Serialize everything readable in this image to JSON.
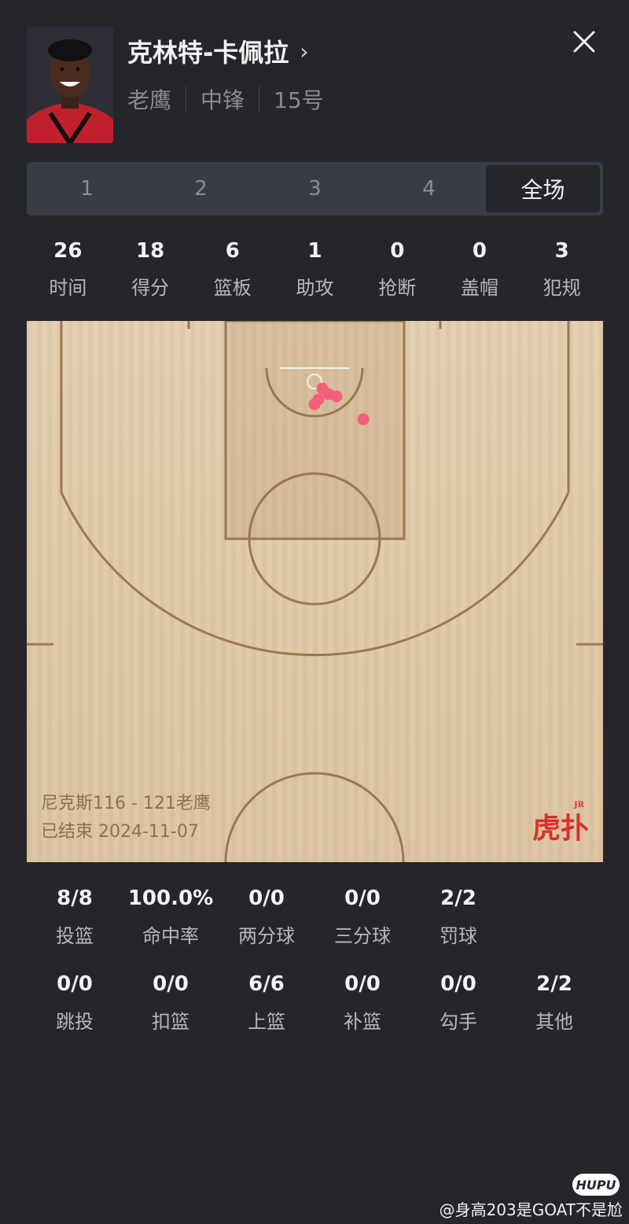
{
  "player": {
    "name": "克林特-卡佩拉",
    "team": "老鹰",
    "position": "中锋",
    "number": "15号"
  },
  "tabs": [
    {
      "label": "1",
      "active": false
    },
    {
      "label": "2",
      "active": false
    },
    {
      "label": "3",
      "active": false
    },
    {
      "label": "4",
      "active": false
    },
    {
      "label": "全场",
      "active": true
    }
  ],
  "stats": [
    {
      "label": "时间",
      "value": "26"
    },
    {
      "label": "得分",
      "value": "18"
    },
    {
      "label": "篮板",
      "value": "6"
    },
    {
      "label": "助攻",
      "value": "1"
    },
    {
      "label": "抢断",
      "value": "0"
    },
    {
      "label": "盖帽",
      "value": "0"
    },
    {
      "label": "犯规",
      "value": "3"
    }
  ],
  "game": {
    "score_line": "尼克斯116 - 121老鹰",
    "status_line": "已结束 2024-11-07"
  },
  "logo": {
    "text": "虎扑",
    "badge": "JR"
  },
  "shot_stats_row1": [
    {
      "label": "投篮",
      "value": "8/8"
    },
    {
      "label": "命中率",
      "value": "100.0%"
    },
    {
      "label": "两分球",
      "value": "0/0"
    },
    {
      "label": "三分球",
      "value": "0/0"
    },
    {
      "label": "罚球",
      "value": "2/2"
    }
  ],
  "shot_stats_row2": [
    {
      "label": "跳投",
      "value": "0/0"
    },
    {
      "label": "扣篮",
      "value": "0/0"
    },
    {
      "label": "上篮",
      "value": "6/6"
    },
    {
      "label": "补篮",
      "value": "0/0"
    },
    {
      "label": "勾手",
      "value": "0/0"
    },
    {
      "label": "其他",
      "value": "2/2"
    }
  ],
  "footer": {
    "hupu_badge": "HUPU",
    "watermark": "@身高203是GOAT不是尬"
  },
  "colors": {
    "background": "#25262c",
    "made_shot": "#f2607a",
    "court_line": "#9a7752"
  }
}
